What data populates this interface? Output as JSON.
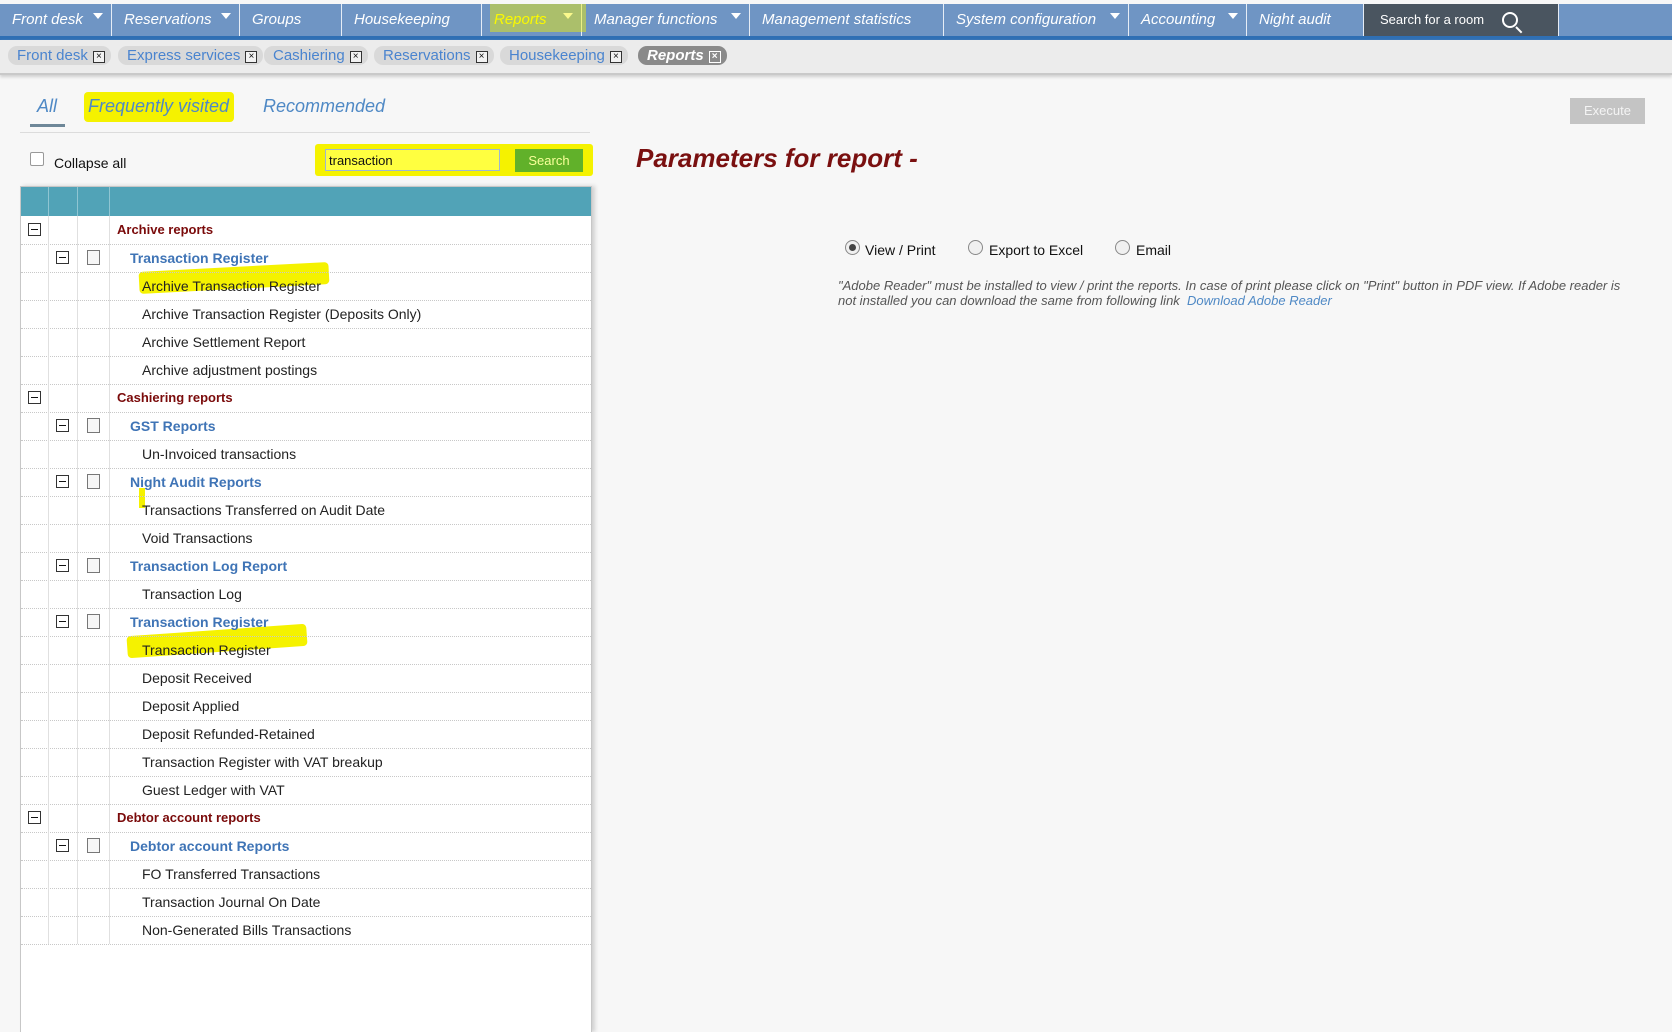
{
  "nav": {
    "items": [
      {
        "label": "Front desk",
        "dropdown": true
      },
      {
        "label": "Reservations",
        "dropdown": true
      },
      {
        "label": "Groups",
        "dropdown": false
      },
      {
        "label": "Housekeeping",
        "dropdown": false
      },
      {
        "label": "Reports",
        "dropdown": true
      },
      {
        "label": "Manager functions",
        "dropdown": true
      },
      {
        "label": "Management statistics",
        "dropdown": false
      },
      {
        "label": "System configuration",
        "dropdown": true
      },
      {
        "label": "Accounting",
        "dropdown": true
      },
      {
        "label": "Night audit",
        "dropdown": false
      }
    ],
    "search_label": "Search for a room"
  },
  "open_tabs": [
    "Front desk",
    "Express services",
    "Cashiering",
    "Reservations",
    "Housekeeping",
    "Reports"
  ],
  "filter_tabs": {
    "all": "All",
    "frequent": "Frequently visited",
    "recommended": "Recommended"
  },
  "execute_label": "Execute",
  "collapse_label": "Collapse all",
  "search": {
    "value": "transaction",
    "button": "Search"
  },
  "tree": {
    "archive": {
      "title": "Archive reports",
      "group_title": "Transaction Register",
      "items": [
        "Archive Transaction Register",
        "Archive Transaction Register (Deposits Only)",
        "Archive Settlement Report",
        "Archive adjustment postings"
      ]
    },
    "cashiering": {
      "title": "Cashiering reports",
      "gst": {
        "title": "GST Reports",
        "items": [
          "Un-Invoiced transactions"
        ]
      },
      "night_audit": {
        "title": "Night Audit Reports",
        "items": [
          "Transactions Transferred on Audit Date",
          "Void Transactions"
        ]
      },
      "tx_log": {
        "title": "Transaction Log Report",
        "items": [
          "Transaction Log"
        ]
      },
      "tx_register": {
        "title": "Transaction Register",
        "items": [
          "Transaction Register",
          "Deposit Received",
          "Deposit Applied",
          "Deposit Refunded-Retained",
          "Transaction Register with VAT breakup",
          "Guest Ledger with VAT"
        ]
      }
    },
    "debtor": {
      "title": "Debtor account reports",
      "group_title": "Debtor account Reports",
      "items": [
        "FO Transferred Transactions",
        "Transaction Journal On Date",
        "Non-Generated Bills Transactions"
      ]
    }
  },
  "params": {
    "title": "Parameters for report -",
    "options": [
      "View / Print",
      "Export to Excel",
      "Email"
    ],
    "selected": "View / Print",
    "note": "\"Adobe Reader\" must be installed to view / print the reports. In case of print please click on \"Print\" button in PDF view. If Adobe reader is not installed you can download the same from following link",
    "link": "Download Adobe Reader"
  },
  "colors": {
    "nav": "#6f95c4",
    "highlight": "#f5f200",
    "category": "#7a0a0a",
    "group": "#3f74b6",
    "tree_header": "#51a3b7"
  }
}
